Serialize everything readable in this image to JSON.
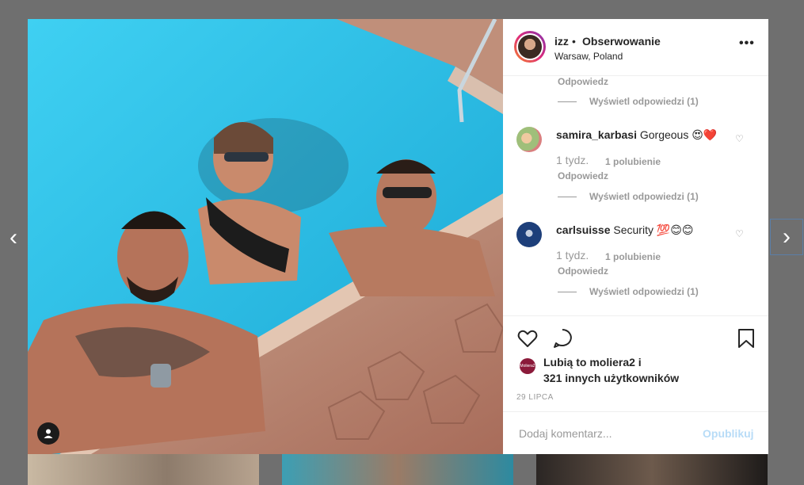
{
  "post": {
    "username": "izz",
    "separator": "•",
    "follow_label": "Obserwowanie",
    "location": "Warsaw, Poland",
    "more_icon": "more-options-icon"
  },
  "comments": [
    {
      "reply_label": "Odpowiedz",
      "view_replies": "Wyświetl odpowiedzi (1)"
    },
    {
      "username": "samira_karbasi",
      "text": "Gorgeous 😍❤️",
      "age": "1 tydz.",
      "likes": "1 polubienie",
      "reply_label": "Odpowiedz",
      "view_replies": "Wyświetl odpowiedzi (1)"
    },
    {
      "username": "carlsuisse",
      "text": "Security 💯😊😊",
      "age": "1 tydz.",
      "likes": "1 polubienie",
      "reply_label": "Odpowiedz",
      "view_replies": "Wyświetl odpowiedzi (1)"
    }
  ],
  "likes": {
    "line1": "Lubią to moliera2 i",
    "line2": "321 innych użytkowników",
    "liker_badge": "Moliera2"
  },
  "date": "29 LIPCA",
  "add_comment": {
    "placeholder": "Dodaj komentarz...",
    "post_label": "Opublikuj"
  },
  "nav": {
    "prev": "‹",
    "next": "›"
  },
  "colors": {
    "pool": "#2fc0e6",
    "link_disabled": "#b8dcf7",
    "gradient_ring": "#dd2a7b"
  }
}
